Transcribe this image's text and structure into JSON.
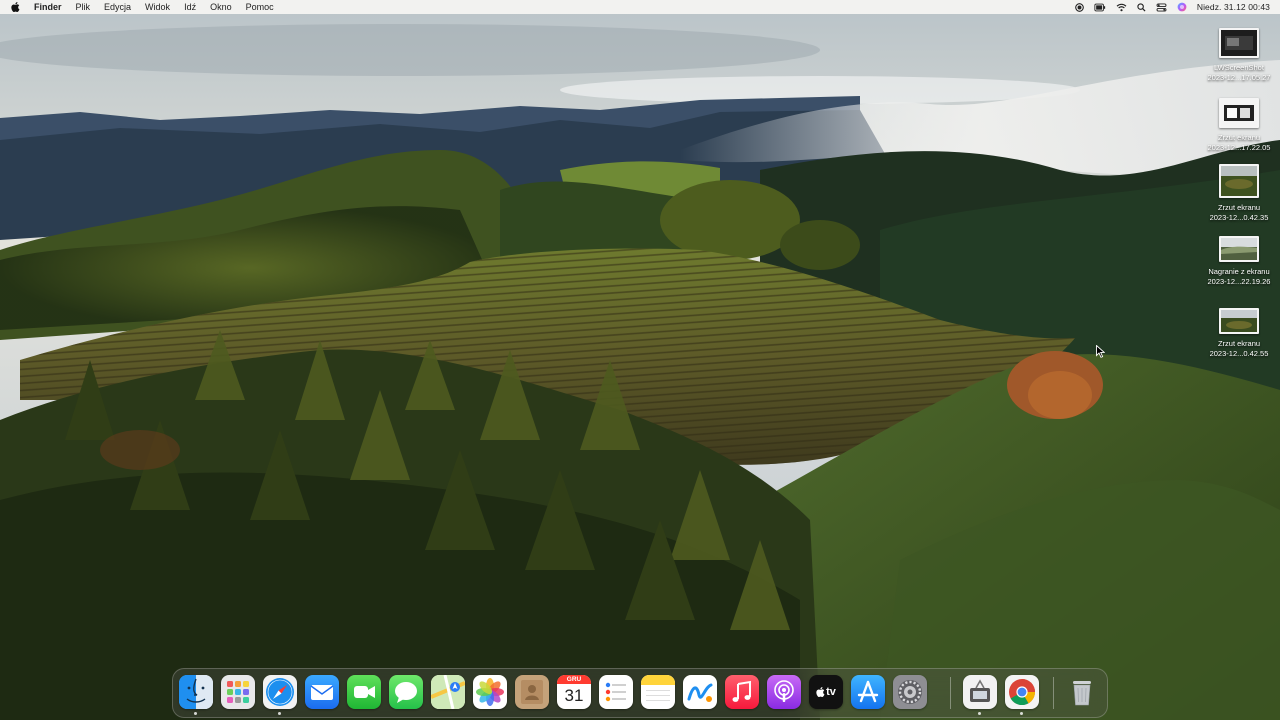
{
  "menubar": {
    "app_name": "Finder",
    "menus": [
      "Plik",
      "Edycja",
      "Widok",
      "Idź",
      "Okno",
      "Pomoc"
    ],
    "status_icons": [
      "record-icon",
      "battery-icon",
      "wifi-icon",
      "search-icon",
      "control-center-icon",
      "siri-icon"
    ],
    "clock": "Niedz. 31.12  00:43"
  },
  "desktop_icons": [
    {
      "name": "LWScreenShot",
      "date": "2023-12...17.05.27"
    },
    {
      "name": "Zrzut ekranu",
      "date": "2023-12...17.22.05"
    },
    {
      "name": "Zrzut ekranu",
      "date": "2023-12...0.42.35"
    },
    {
      "name": "Nagranie z ekranu",
      "date": "2023-12...22.19.26"
    },
    {
      "name": "Zrzut ekranu",
      "date": "2023-12...0.42.55"
    }
  ],
  "dock": {
    "apps": [
      {
        "name": "Finder",
        "icon": "finder-icon",
        "running": true
      },
      {
        "name": "Launchpad",
        "icon": "launchpad-icon",
        "running": false
      },
      {
        "name": "Safari",
        "icon": "safari-icon",
        "running": true
      },
      {
        "name": "Mail",
        "icon": "mail-icon",
        "running": false
      },
      {
        "name": "FaceTime",
        "icon": "facetime-icon",
        "running": false
      },
      {
        "name": "Messages",
        "icon": "messages-icon",
        "running": false
      },
      {
        "name": "Maps",
        "icon": "maps-icon",
        "running": false
      },
      {
        "name": "Photos",
        "icon": "photos-icon",
        "running": false
      },
      {
        "name": "Contacts",
        "icon": "contacts-icon",
        "running": false
      },
      {
        "name": "Calendar",
        "icon": "calendar-icon",
        "running": false
      },
      {
        "name": "Reminders",
        "icon": "reminders-icon",
        "running": false
      },
      {
        "name": "Notes",
        "icon": "notes-icon",
        "running": false
      },
      {
        "name": "Freeform",
        "icon": "freeform-icon",
        "running": false
      },
      {
        "name": "Music",
        "icon": "music-icon",
        "running": false
      },
      {
        "name": "Podcasts",
        "icon": "podcasts-icon",
        "running": false
      },
      {
        "name": "TV",
        "icon": "tv-icon",
        "running": false
      },
      {
        "name": "App Store",
        "icon": "app-store-icon",
        "running": false
      },
      {
        "name": "System Settings",
        "icon": "settings-icon",
        "running": false
      },
      {
        "name": "Screenshot",
        "icon": "screenshot-tool-icon",
        "running": true
      },
      {
        "name": "Chrome",
        "icon": "chrome-icon",
        "running": true
      },
      {
        "name": "Trash",
        "icon": "trash-icon",
        "running": false
      }
    ],
    "calendar_month": "GRU",
    "calendar_day": "31",
    "tv_label": "tv"
  },
  "colors": {
    "menubar_bg": "#f6f5f3",
    "sky": "#dfe2e3",
    "forest": "#2a3a1c",
    "vineyard": "#6a6a2c"
  }
}
